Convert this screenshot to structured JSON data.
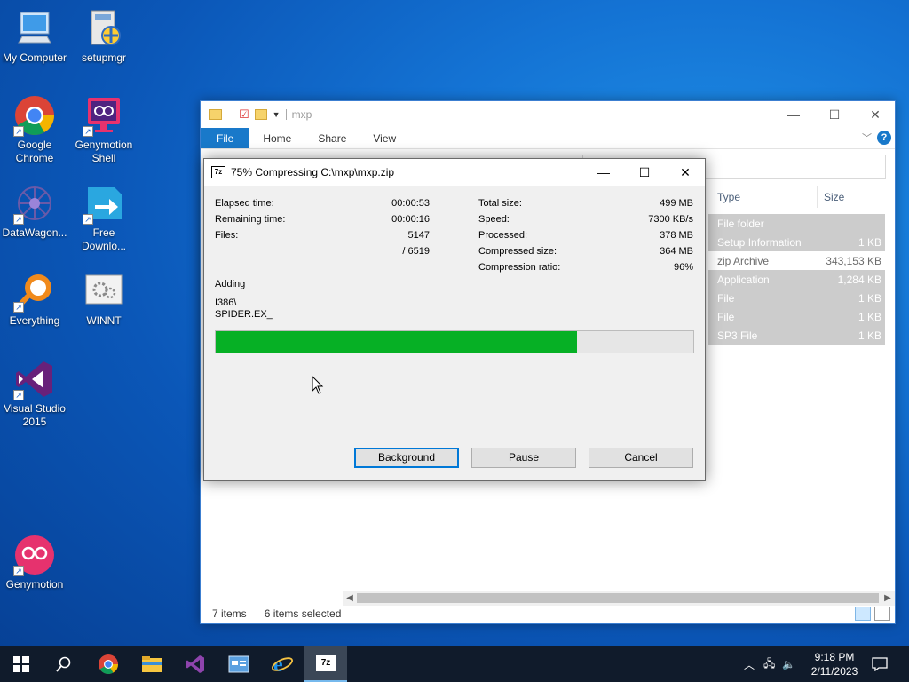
{
  "desktop": {
    "icons": [
      {
        "label": "My Computer"
      },
      {
        "label": "setupmgr"
      },
      {
        "label": "Google Chrome"
      },
      {
        "label": "Genymotion Shell"
      },
      {
        "label": "DataWagon..."
      },
      {
        "label": "Free Downlo..."
      },
      {
        "label": "Everything"
      },
      {
        "label": "WINNT"
      },
      {
        "label": "Visual Studio 2015"
      },
      {
        "label": "Genymotion"
      }
    ]
  },
  "explorer": {
    "title": "mxp",
    "ribbon_tabs": [
      "File",
      "Home",
      "Share",
      "View"
    ],
    "help_label": "?",
    "columns": {
      "type": "Type",
      "size": "Size"
    },
    "rows": [
      {
        "type": "File folder",
        "size": "",
        "selected": true
      },
      {
        "type": "Setup Information",
        "size": "1 KB",
        "selected": true
      },
      {
        "type": "zip Archive",
        "size": "343,153 KB",
        "selected": false
      },
      {
        "type": "Application",
        "size": "1,284 KB",
        "selected": true
      },
      {
        "type": "File",
        "size": "1 KB",
        "selected": true
      },
      {
        "type": "File",
        "size": "1 KB",
        "selected": true
      },
      {
        "type": "SP3 File",
        "size": "1 KB",
        "selected": true
      }
    ],
    "status": {
      "items": "7 items",
      "selected": "6 items selected"
    }
  },
  "dialog": {
    "icon_label": "7z",
    "title": "75% Compressing C:\\mxp\\mxp.zip",
    "left_stats": {
      "elapsed_label": "Elapsed time:",
      "elapsed_value": "00:00:53",
      "remaining_label": "Remaining time:",
      "remaining_value": "00:00:16",
      "files_label": "Files:",
      "files_value": "5147",
      "files_total": "/ 6519"
    },
    "right_stats": {
      "total_label": "Total size:",
      "total_value": "499 MB",
      "speed_label": "Speed:",
      "speed_value": "7300 KB/s",
      "processed_label": "Processed:",
      "processed_value": "378 MB",
      "compressed_label": "Compressed size:",
      "compressed_value": "364 MB",
      "ratio_label": "Compression ratio:",
      "ratio_value": "96%"
    },
    "action": "Adding",
    "current_dir": "I386\\",
    "current_file": "SPIDER.EX_",
    "progress": 0.757,
    "buttons": {
      "background": "Background",
      "pause": "Pause",
      "cancel": "Cancel"
    }
  },
  "taskbar": {
    "time": "9:18 PM",
    "date": "2/11/2023",
    "active_app_label": "7z"
  },
  "colors": {
    "progress_fill": "#06b025",
    "accent": "#1979ca"
  }
}
